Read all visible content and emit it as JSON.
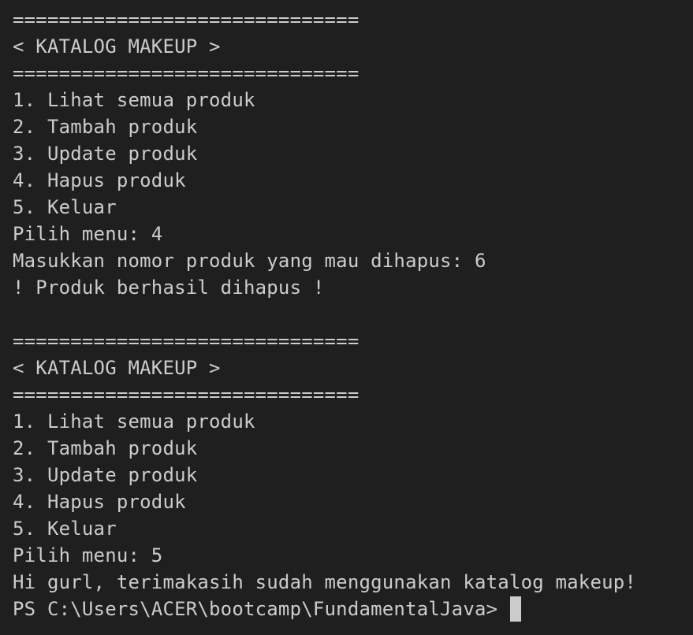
{
  "terminal": {
    "colors": {
      "background": "#1f1f1f",
      "foreground": "#cccccc",
      "cursor": "#cccccc"
    },
    "block1": {
      "separator_top": "==============================",
      "title": "< KATALOG MAKEUP >",
      "separator_bottom": "==============================",
      "menu_items": [
        "1. Lihat semua produk",
        "2. Tambah produk",
        "3. Update produk",
        "4. Hapus produk",
        "5. Keluar"
      ],
      "pilih_menu": "Pilih menu: 4",
      "input_prompt": "Masukkan nomor produk yang mau dihapus: 6",
      "message": "! Produk berhasil dihapus !"
    },
    "block2": {
      "separator_top": "==============================",
      "title": "< KATALOG MAKEUP >",
      "separator_bottom": "==============================",
      "menu_items": [
        "1. Lihat semua produk",
        "2. Tambah produk",
        "3. Update produk",
        "4. Hapus produk",
        "5. Keluar"
      ],
      "pilih_menu": "Pilih menu: 5",
      "goodbye": "Hi gurl, terimakasih sudah menggunakan katalog makeup!"
    },
    "shell_prompt": "PS C:\\Users\\ACER\\bootcamp\\FundamentalJava>"
  }
}
